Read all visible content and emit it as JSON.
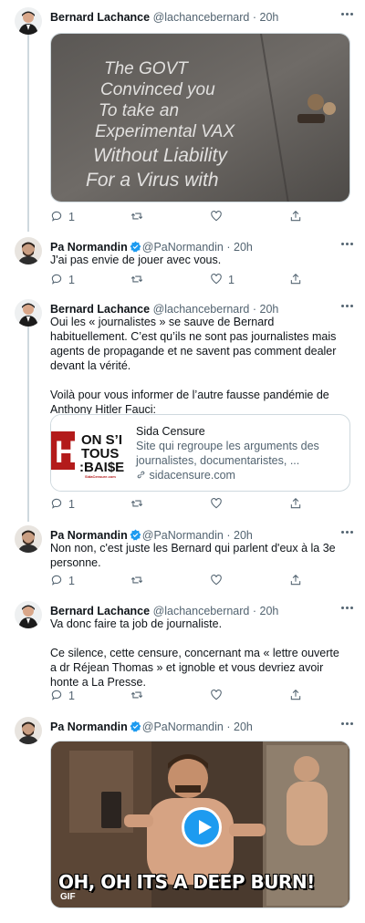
{
  "colors": {
    "text": "#0f1419",
    "muted": "#536471",
    "accent": "#1d9bf0",
    "border": "#cfd9de"
  },
  "tweets": [
    {
      "name": "Bernard Lachance",
      "handle": "@lachancebernard",
      "time": "20h",
      "media_text": [
        "The GOVT",
        "Convinced you",
        "To take an",
        "Experimental VAX",
        "Without Liability",
        "For a Virus with"
      ],
      "reply_count": "1",
      "like_count": ""
    },
    {
      "name": "Pa Normandin",
      "handle": "@PaNormandin",
      "time": "20h",
      "text": "J'ai pas envie de jouer avec vous.",
      "reply_count": "1",
      "like_count": "1"
    },
    {
      "name": "Bernard Lachance",
      "handle": "@lachancebernard",
      "time": "20h",
      "text_1": "Oui les « journalistes » se sauve de Bernard habituellement. C’est qu’ils ne sont pas journalistes mais agents de propagande et ne savent pas comment dealer devant la vérité.",
      "text_2": "Voilà pour vous informer de l’autre fausse pandémie de Anthony Hitler Fauci:",
      "card": {
        "site": "Sida Censure",
        "description": "Site qui regroupe les arguments des journalistes, documentaristes, ...",
        "url": "sidacensure.com",
        "thumb_letter": "H",
        "thumb_lines": [
          "ON S’I",
          "TOUS",
          ":BAI$E"
        ],
        "thumb_small": "SidaCensure.com"
      },
      "reply_count": "1",
      "like_count": ""
    },
    {
      "name": "Pa Normandin",
      "handle": "@PaNormandin",
      "time": "20h",
      "text": "Non non, c'est juste les Bernard qui parlent d'eux à la 3e personne.",
      "reply_count": "1",
      "like_count": ""
    },
    {
      "name": "Bernard Lachance",
      "handle": "@lachancebernard",
      "time": "20h",
      "text_1": "Va donc faire ta job de journaliste.",
      "text_2": "Ce silence, cette censure, concernant ma « lettre ouverte a dr Réjean Thomas » et ignoble et vous devriez avoir honte a La Presse.",
      "reply_count": "1",
      "like_count": ""
    },
    {
      "name": "Pa Normandin",
      "handle": "@PaNormandin",
      "time": "20h",
      "gif_caption": "OH, OH ITS A DEEP BURN!",
      "gif_badge": "GIF"
    }
  ],
  "icons": [
    "reply-icon",
    "retweet-icon",
    "like-icon",
    "share-icon",
    "more-icon",
    "verified-icon",
    "link-icon",
    "play-icon"
  ]
}
